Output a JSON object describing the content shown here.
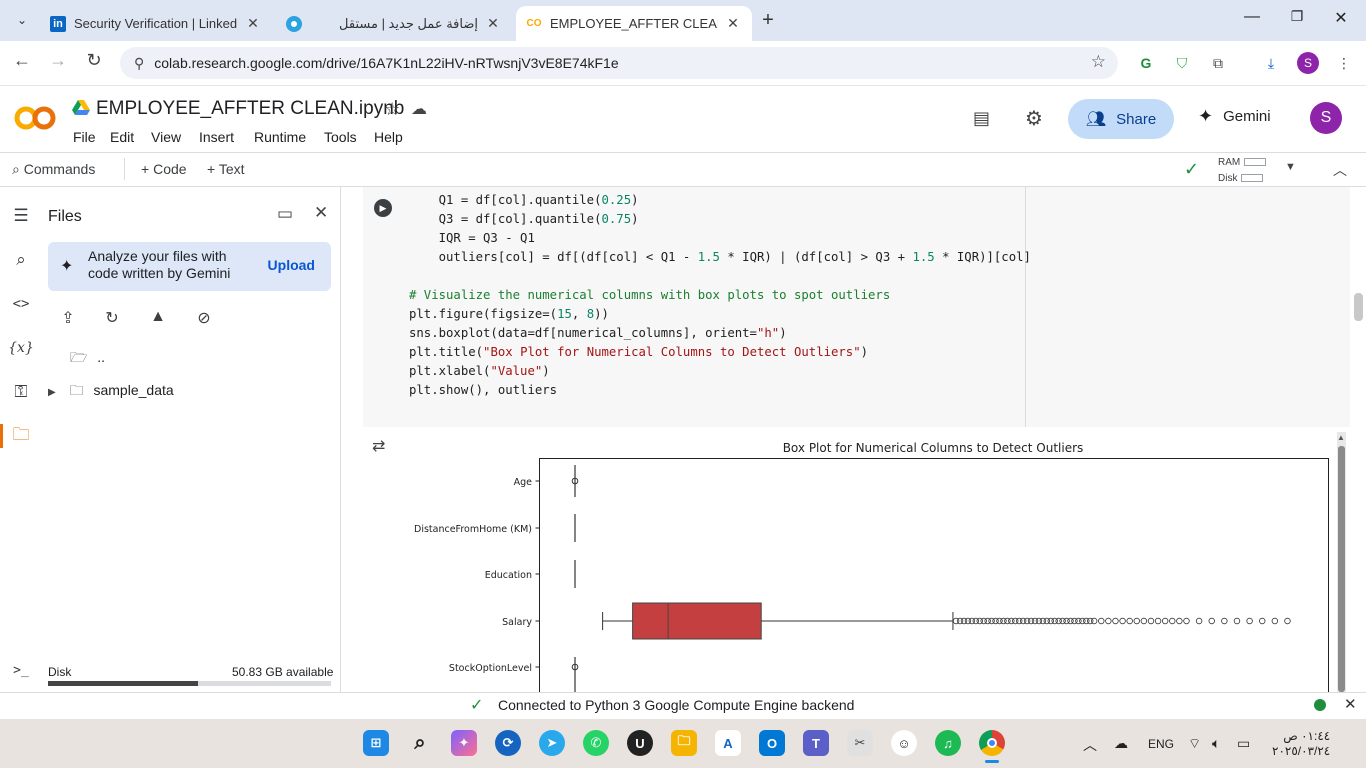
{
  "browser": {
    "tabs": [
      {
        "title": "Security Verification | LinkedIn",
        "favicon": "linkedin-icon",
        "active": false
      },
      {
        "title": "إضافة عمل جديد | مستقل",
        "favicon": "mostaql-icon",
        "active": false
      },
      {
        "title": "EMPLOYEE_AFFTER CLEAN.ipynb",
        "favicon": "colab-icon",
        "active": true
      }
    ],
    "url": "colab.research.google.com/drive/16A7K1nL22iHV-nRTwsnjV3vE8E74kF1e",
    "profile_initial": "S"
  },
  "colab": {
    "notebook_title": "EMPLOYEE_AFFTER CLEAN.ipynb",
    "logo_text": "CO",
    "menu": [
      "File",
      "Edit",
      "View",
      "Insert",
      "Runtime",
      "Tools",
      "Help"
    ],
    "share_label": "Share",
    "gemini_label": "Gemini",
    "avatar_initial": "S",
    "commands_label": "Commands",
    "code_label": "Code",
    "text_label": "Text",
    "ram_label": "RAM",
    "disk_label": "Disk"
  },
  "files_panel": {
    "title": "Files",
    "gemini_card_text": "Analyze your files with code written by Gemini",
    "upload_label": "Upload",
    "tree": [
      {
        "name": "..",
        "type": "parent"
      },
      {
        "name": "sample_data",
        "type": "folder"
      }
    ],
    "disk_label": "Disk",
    "disk_available": "50.83 GB available",
    "disk_used_fraction": 0.53
  },
  "code_cell": {
    "lines": [
      "    Q1 = df[col].quantile(0.25)",
      "    Q3 = df[col].quantile(0.75)",
      "    IQR = Q3 - Q1",
      "    outliers[col] = df[(df[col] < Q1 - 1.5 * IQR) | (df[col] > Q3 + 1.5 * IQR)][col]",
      "",
      "# Visualize the numerical columns with box plots to spot outliers",
      "plt.figure(figsize=(15, 8))",
      "sns.boxplot(data=df[numerical_columns], orient=\"h\")",
      "plt.title(\"Box Plot for Numerical Columns to Detect Outliers\")",
      "plt.xlabel(\"Value\")",
      "plt.show(), outliers"
    ]
  },
  "chart_data": {
    "type": "box",
    "title": "Box Plot for Numerical Columns to Detect Outliers",
    "orientation": "horizontal",
    "categories": [
      "Age",
      "DistanceFromHome (KM)",
      "Education",
      "Salary",
      "StockOptionLevel"
    ],
    "box_color": "#c44040",
    "note": "Salary box spans roughly 0.12–0.28 of axis; whisker to ~0.52 with many outlier points to ~0.96"
  },
  "status": {
    "text": "Connected to Python 3 Google Compute Engine backend"
  },
  "taskbar": {
    "lang": "ENG",
    "time": "٠١:٤٤ ص",
    "date": "٢٠٢٥/٠٣/٢٤"
  }
}
